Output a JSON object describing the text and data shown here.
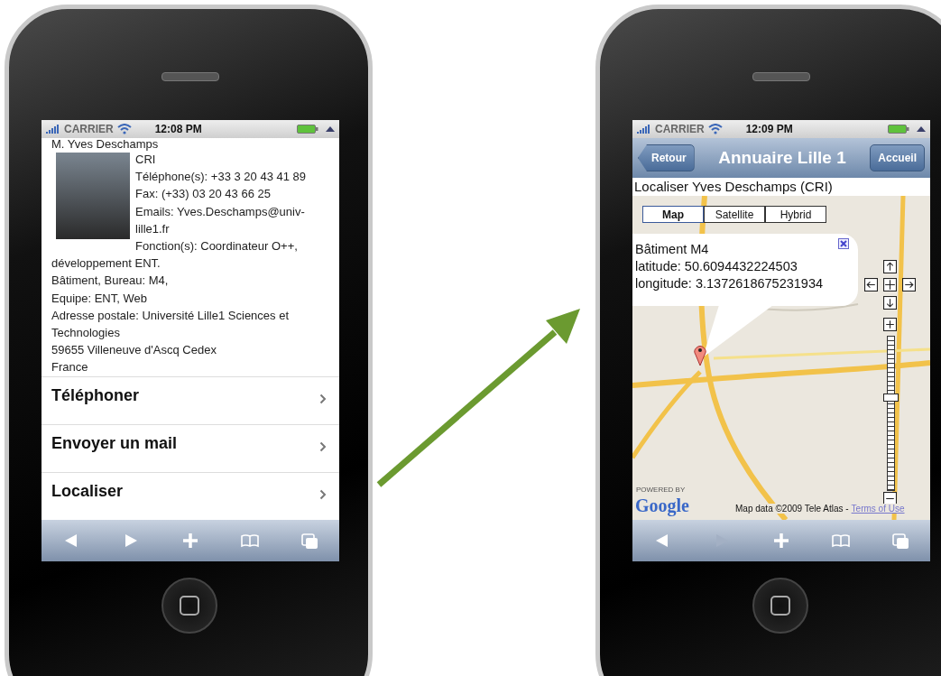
{
  "phones": [
    {
      "kind": "contact",
      "status_bar": {
        "carrier": "CARRIER",
        "time": "12:08 PM"
      },
      "contact": {
        "name": "M. Yves Deschamps",
        "side_lines": [
          "CRI",
          "Téléphone(s): +33 3 20 43 41 89",
          "Fax: (+33) 03 20 43 66 25",
          "Emails: Yves.Deschamps@univ-lille1.fr",
          "Fonction(s): Coordinateur O++, développement ENT."
        ],
        "lines": [
          "Bâtiment, Bureau: M4,",
          "Equipe: ENT, Web",
          "Adresse postale: Université Lille1 Sciences et Technologies",
          "59655 Villeneuve d'Ascq Cedex",
          "France"
        ]
      },
      "actions": [
        {
          "label": "Téléphoner"
        },
        {
          "label": "Envoyer un mail"
        },
        {
          "label": "Localiser"
        }
      ],
      "toolbar": [
        {
          "kind": "back",
          "disabled": false
        },
        {
          "kind": "forward",
          "disabled": false
        },
        {
          "kind": "add",
          "disabled": false
        },
        {
          "kind": "bookmarks",
          "disabled": false
        },
        {
          "kind": "pages",
          "disabled": false
        }
      ]
    },
    {
      "kind": "map",
      "status_bar": {
        "carrier": "CARRIER",
        "time": "12:09 PM"
      },
      "nav_bar": {
        "back": "Retour",
        "title": "Annuaire Lille 1",
        "home": "Accueil"
      },
      "heading": "Localiser Yves Deschamps (CRI)",
      "map": {
        "types": [
          {
            "label": "Map",
            "selected": true
          },
          {
            "label": "Satellite",
            "selected": false
          },
          {
            "label": "Hybrid",
            "selected": false
          }
        ],
        "info": [
          "Bâtiment M4",
          "latitude: 50.6094432224503",
          "longitude: 3.1372618675231934"
        ],
        "zoom": {
          "level": 0.6
        },
        "powered_by": "POWERED BY",
        "logo": "Google",
        "credit": "Map data ©2009 Tele Atlas -",
        "terms": "Terms of Use"
      },
      "toolbar": [
        {
          "kind": "back",
          "disabled": false
        },
        {
          "kind": "forward",
          "disabled": true
        },
        {
          "kind": "add",
          "disabled": false
        },
        {
          "kind": "bookmarks",
          "disabled": false
        },
        {
          "kind": "pages",
          "disabled": false
        }
      ]
    }
  ]
}
